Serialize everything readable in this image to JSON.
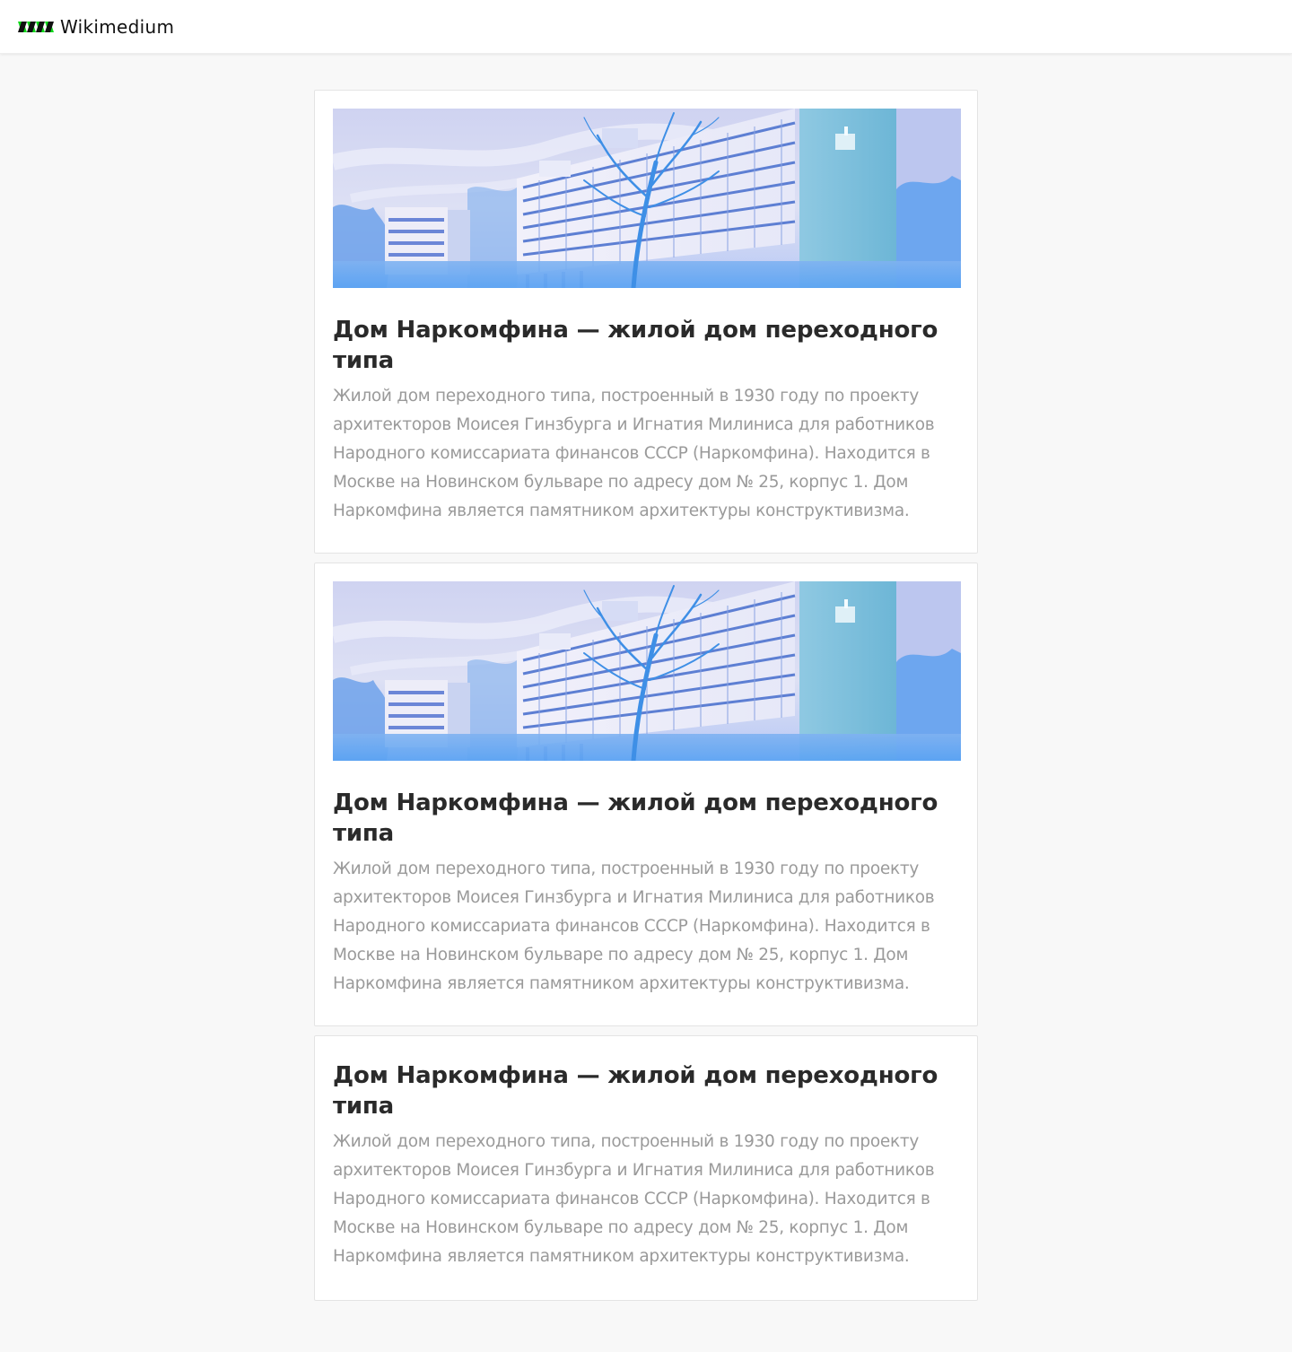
{
  "header": {
    "brand_name": "Wikimedium",
    "logo_icon": "wikimedium-logo-icon",
    "logo_colors": [
      "#111111",
      "#10d81a"
    ]
  },
  "feed": {
    "articles": [
      {
        "image_icon": "narkomfin-building-photo",
        "title": "Дом Наркомфина — жилой дом переходного типа",
        "text": "Жилой дом переходного типа, построенный в 1930 году по проекту архитекторов Моисея Гинзбурга и Игнатия Милиниса для работников Народного комиссариата финансов СССР (Наркомфина). Находится в Москве на Новинском бульваре по адресу дом № 25, корпус 1. Дом Наркомфина является памятником архитектуры конструктивизма."
      },
      {
        "image_icon": "narkomfin-building-photo",
        "title": "Дом Наркомфина — жилой дом переходного типа",
        "text": "Жилой дом переходного типа, построенный в 1930 году по проекту архитекторов Моисея Гинзбурга и Игнатия Милиниса для работников Народного комиссариата финансов СССР (Наркомфина). Находится в Москве на Новинском бульваре по адресу дом № 25, корпус 1. Дом Наркомфина является памятником архитектуры конструктивизма."
      },
      {
        "title": "Дом Наркомфина — жилой дом переходного типа",
        "text": "Жилой дом переходного типа, построенный в 1930 году по проекту архитекторов Моисея Гинзбурга и Игнатия Милиниса для работников Народного комиссариата финансов СССР (Наркомфина). Находится в Москве на Новинском бульваре по адресу дом № 25, корпус 1. Дом Наркомфина является памятником архитектуры конструктивизма."
      }
    ]
  }
}
